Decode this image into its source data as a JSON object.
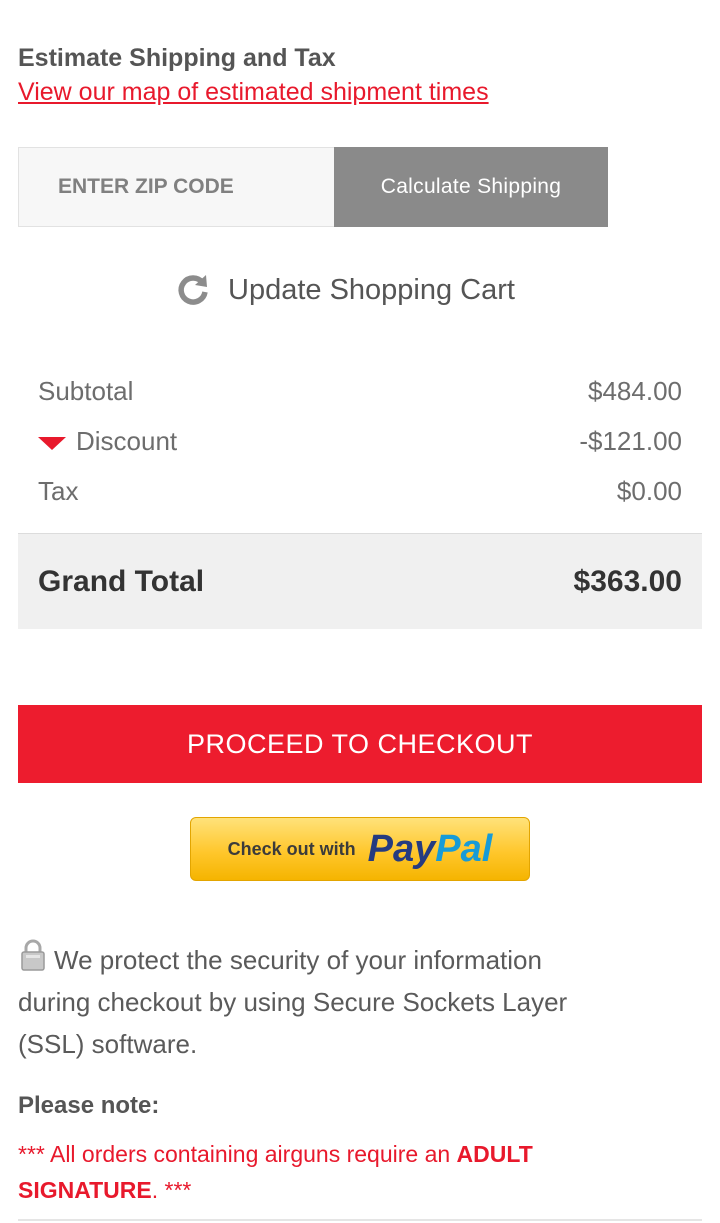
{
  "shipping": {
    "title": "Estimate Shipping and Tax",
    "map_link": "View our map of estimated shipment times",
    "zip_placeholder": "ENTER ZIP CODE",
    "calculate_label": "Calculate Shipping"
  },
  "cart": {
    "update_label": "Update Shopping Cart",
    "update_icon": "refresh-icon"
  },
  "totals": {
    "subtotal_label": "Subtotal",
    "subtotal_value": "$484.00",
    "discount_label": "Discount",
    "discount_value": "-$121.00",
    "tax_label": "Tax",
    "tax_value": "$0.00",
    "grand_total_label": "Grand Total",
    "grand_total_value": "$363.00"
  },
  "checkout": {
    "proceed_label": "PROCEED TO CHECKOUT",
    "paypal_prefix": "Check out with",
    "paypal_pay": "Pay",
    "paypal_pal": "Pal"
  },
  "security": {
    "icon": "lock-icon",
    "text": "We protect the security of your information during checkout by using Secure Sockets Layer (SSL) software."
  },
  "note": {
    "heading": "Please note:",
    "prefix": "*** All orders containing airguns require an ",
    "emphasis": "ADULT SIGNATURE",
    "suffix": ". ***"
  },
  "colors": {
    "accent": "#ed1c2e",
    "button_gray": "#8a8a8a",
    "total_bg": "#f0f0f0",
    "paypal_yellow": "#ffc72c"
  }
}
